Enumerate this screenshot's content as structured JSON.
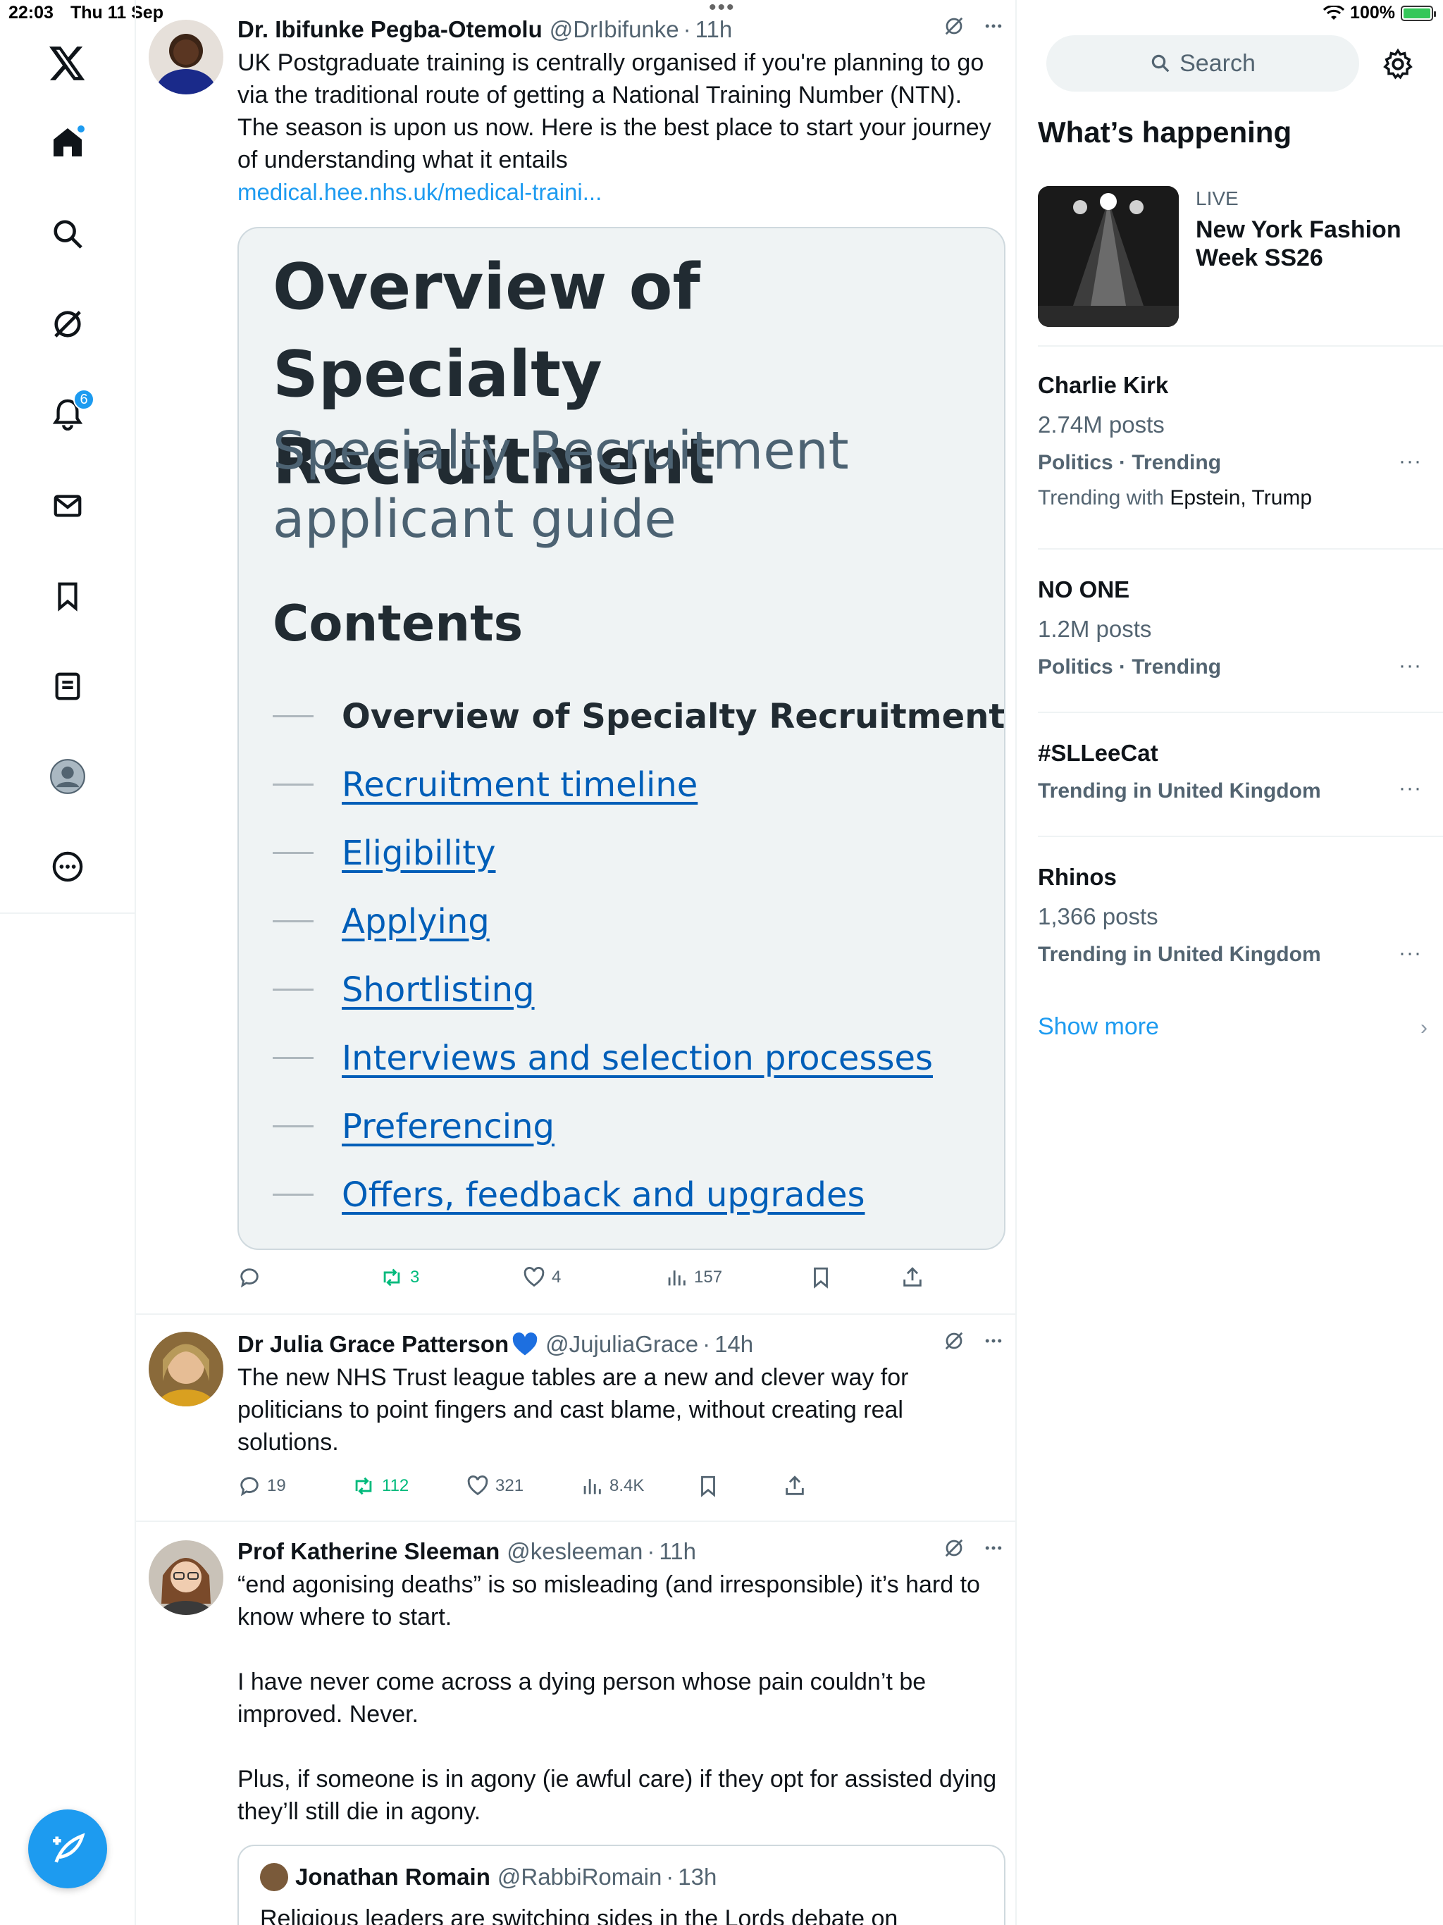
{
  "status": {
    "time": "22:03",
    "date": "Thu 11 Sep",
    "battery": "100%"
  },
  "nav": {
    "items": [
      "home",
      "search",
      "grok",
      "notifications",
      "messages",
      "bookmarks",
      "lists",
      "profile",
      "more"
    ],
    "notifications_count": "6"
  },
  "tweets": [
    {
      "name": "Dr. Ibifunke Pegba-Otemolu",
      "handle": "@DrIbifunke",
      "dot": "·",
      "time": "11h",
      "text": "UK Postgraduate training is centrally organised if you're planning to go via the traditional route of getting a National Training Number (NTN). The season is upon us now. Here is the best place to start your journey of understanding what it entails",
      "link": "medical.hee.nhs.uk/medical-traini...",
      "card": {
        "title": "Overview of Specialty Recruitment",
        "subtitle": "Specialty Recruitment applicant guide",
        "contents_heading": "Contents",
        "toc": [
          "Overview of Specialty Recruitment",
          "Recruitment timeline",
          "Eligibility",
          "Applying",
          "Shortlisting",
          "Interviews and selection processes",
          "Preferencing",
          "Offers, feedback and upgrades"
        ]
      },
      "replies": "",
      "reposts": "3",
      "likes": "4",
      "views": "157"
    },
    {
      "name": "Dr Julia Grace Patterson",
      "handle": "@JujuliaGrace",
      "dot": "·",
      "time": "14h",
      "text": "The new NHS Trust league tables are a new and clever way for politicians to point fingers and cast blame, without creating real solutions.",
      "replies": "19",
      "reposts": "112",
      "likes": "321",
      "views": "8.4K"
    },
    {
      "name": "Prof Katherine Sleeman",
      "handle": "@kesleeman",
      "dot": "·",
      "time": "11h",
      "text1": "“end agonising deaths” is so misleading (and irresponsible) it’s hard to know where to start.",
      "text2": "I have never come across a dying person whose pain couldn’t be improved. Never.",
      "text3": "Plus, if someone is in agony (ie awful care) if they opt for assisted dying they’ll still die in agony.",
      "quote": {
        "name": "Jonathan Romain",
        "handle": "@RabbiRomain",
        "dot": "·",
        "time": "13h",
        "text": "Religious leaders are switching sides in the Lords debate on"
      }
    }
  ],
  "sidebar": {
    "search_label": "Search",
    "heading": "What’s happening",
    "live": {
      "tag": "LIVE",
      "title": "New York Fashion Week SS26"
    },
    "trends": [
      {
        "name": "Charlie Kirk",
        "posts": "2.74M posts",
        "category": "Politics · Trending",
        "with_prefix": "Trending with",
        "with": "Epstein, Trump"
      },
      {
        "name": "NO ONE",
        "posts": "1.2M posts",
        "category": "Politics · Trending"
      },
      {
        "name": "#SLLeeCat",
        "category": "Trending in United Kingdom"
      },
      {
        "name": "Rhinos",
        "posts": "1,366 posts",
        "category": "Trending in United Kingdom"
      }
    ],
    "show_more": "Show more"
  },
  "colors": {
    "accent": "#1d9bf0",
    "repost": "#00ba7c",
    "nhs_blue": "#005eb8"
  }
}
